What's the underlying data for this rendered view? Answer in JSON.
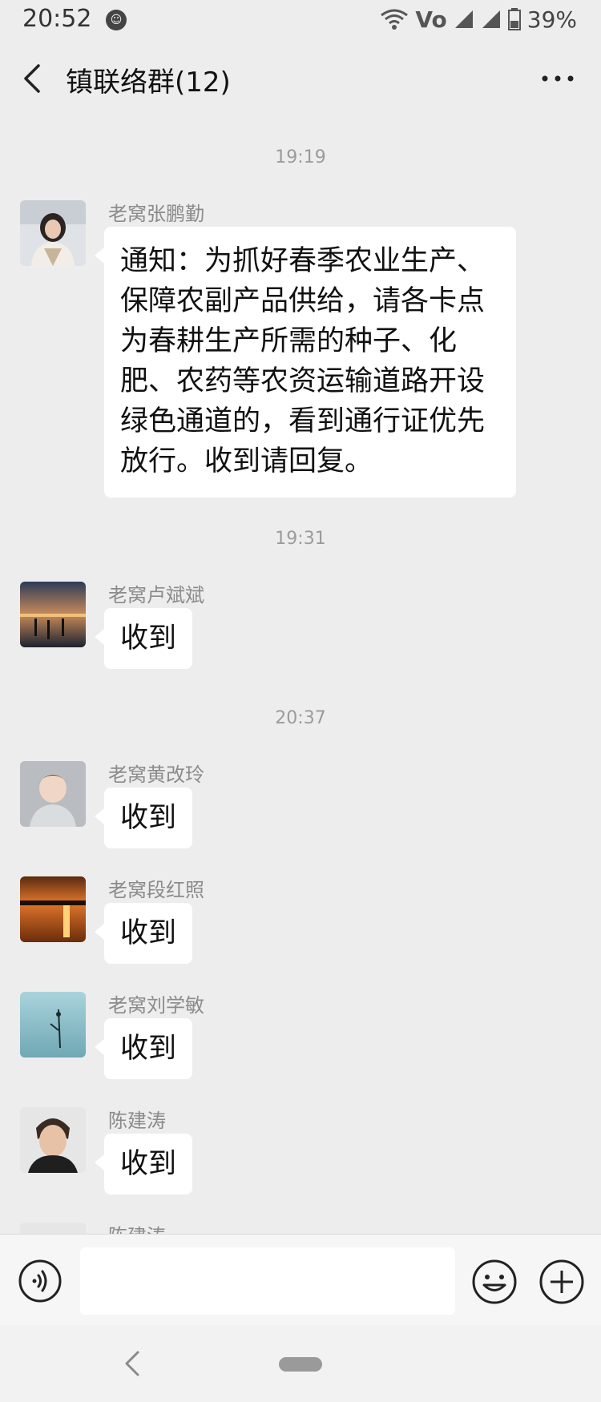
{
  "status_bar": {
    "time": "20:52",
    "notification_badge": "",
    "network_label": "Vo",
    "battery": "39%"
  },
  "header": {
    "title": "镇联络群(12)"
  },
  "chat": {
    "time_labels": [
      "19:19",
      "19:31",
      "20:37"
    ],
    "messages": [
      {
        "sender": "老窝张鹏勤",
        "text": "通知：为抓好春季农业生产、保障农副产品供给，请各卡点为春耕生产所需的种子、化肥、农药等农资运输道路开设绿色通道的，看到通行证优先放行。收到请回复。"
      },
      {
        "sender": "老窝卢斌斌",
        "text": "收到"
      },
      {
        "sender": "老窝黄改玲",
        "text": "收到"
      },
      {
        "sender": "老窝段红照",
        "text": "收到"
      },
      {
        "sender": "老窝刘学敏",
        "text": "收到"
      },
      {
        "sender": "陈建涛",
        "text": "收到"
      },
      {
        "sender": "陈建涛",
        "text": ""
      }
    ]
  },
  "input_bar": {
    "placeholder": ""
  },
  "colors": {
    "chat_background": "#ededed",
    "bubble": "#ffffff",
    "meta_text": "#9b9b9b"
  },
  "icons": [
    "back-arrow-icon",
    "more-icon",
    "voice-icon",
    "emoji-icon",
    "plus-icon",
    "wifi-icon",
    "signal-icon",
    "battery-icon"
  ]
}
